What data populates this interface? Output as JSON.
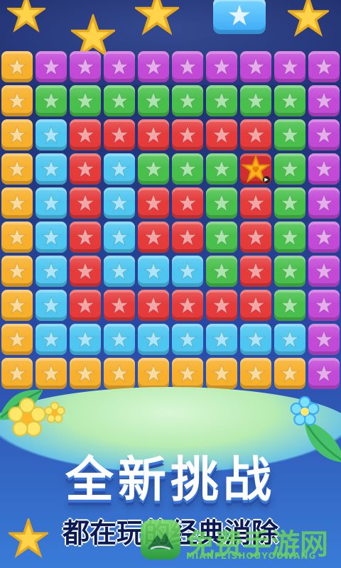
{
  "screen": {
    "title": "全新挑战",
    "subtitle": "都在玩的经典消除",
    "watermark_main": "免费手游网",
    "watermark_sub": "MIANFEISHOUYOUWANG"
  },
  "board": {
    "rows": 10,
    "cols": 10,
    "tiles": [
      [
        "orange",
        "purple",
        "purple",
        "purple",
        "purple",
        "purple",
        "purple",
        "purple",
        "purple",
        "purple"
      ],
      [
        "orange",
        "green",
        "green",
        "green",
        "green",
        "green",
        "green",
        "green",
        "green",
        "purple"
      ],
      [
        "orange",
        "blue",
        "red",
        "red",
        "red",
        "red",
        "red",
        "red",
        "green",
        "purple"
      ],
      [
        "orange",
        "blue",
        "red",
        "blue",
        "green",
        "green",
        "green",
        "special",
        "green",
        "purple"
      ],
      [
        "orange",
        "blue",
        "red",
        "blue",
        "red",
        "red",
        "green",
        "red",
        "green",
        "purple"
      ],
      [
        "orange",
        "blue",
        "red",
        "blue",
        "red",
        "red",
        "green",
        "red",
        "green",
        "purple"
      ],
      [
        "orange",
        "blue",
        "red",
        "blue",
        "blue",
        "blue",
        "green",
        "red",
        "green",
        "purple"
      ],
      [
        "orange",
        "blue",
        "red",
        "red",
        "red",
        "red",
        "red",
        "red",
        "green",
        "purple"
      ],
      [
        "orange",
        "blue",
        "blue",
        "blue",
        "blue",
        "blue",
        "blue",
        "blue",
        "blue",
        "purple"
      ],
      [
        "orange",
        "orange",
        "orange",
        "orange",
        "orange",
        "orange",
        "orange",
        "orange",
        "orange",
        "purple"
      ]
    ],
    "special_tile": {
      "row": 3,
      "col": 7,
      "badge": "▶"
    }
  },
  "colors": {
    "orange": "#f7b02b",
    "purple": "#c34ad6",
    "green": "#49c04b",
    "blue": "#4ec6ef",
    "red": "#e53b3b",
    "special": "#ffb21a",
    "starFill": "#ffffff"
  },
  "icons": {
    "tile_star": "star-icon",
    "sky_star": "star-icon",
    "badge": "play-icon",
    "leaf": "leaf-icon",
    "flower": "flower-icon",
    "watermark_logo": "mountain-logo-icon"
  }
}
